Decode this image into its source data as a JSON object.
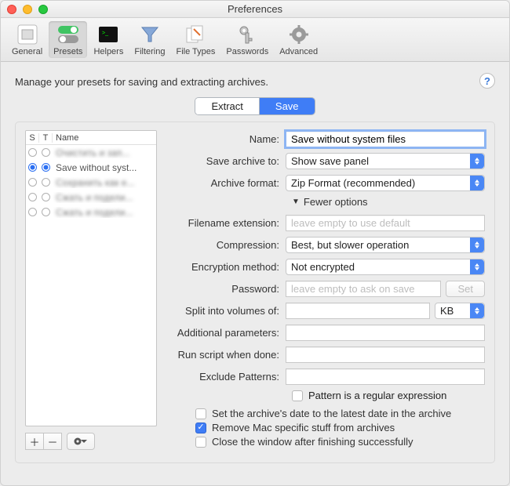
{
  "window": {
    "title": "Preferences"
  },
  "toolbar": {
    "items": [
      {
        "id": "general",
        "label": "General"
      },
      {
        "id": "presets",
        "label": "Presets"
      },
      {
        "id": "helpers",
        "label": "Helpers"
      },
      {
        "id": "filtering",
        "label": "Filtering"
      },
      {
        "id": "filetypes",
        "label": "File Types"
      },
      {
        "id": "passwords",
        "label": "Passwords"
      },
      {
        "id": "advanced",
        "label": "Advanced"
      }
    ],
    "selected": "presets"
  },
  "description": "Manage your presets for saving and extracting archives.",
  "tabs": {
    "extract": "Extract",
    "save": "Save",
    "active": "save"
  },
  "preset_list": {
    "headers": {
      "s": "S",
      "t": "T",
      "name": "Name"
    },
    "rows": [
      {
        "s": false,
        "t": false,
        "name": "Очистить и зап...",
        "blurred": true
      },
      {
        "s": true,
        "t": true,
        "name": "Save without syst...",
        "blurred": false
      },
      {
        "s": false,
        "t": false,
        "name": "Сохранить как е...",
        "blurred": true
      },
      {
        "s": false,
        "t": false,
        "name": "Сжать и подели...",
        "blurred": true
      },
      {
        "s": false,
        "t": false,
        "name": "Сжать и подели...",
        "blurred": true
      }
    ]
  },
  "form": {
    "name_label": "Name:",
    "name_value": "Save without system files",
    "save_to_label": "Save archive to:",
    "save_to_value": "Show save panel",
    "format_label": "Archive format:",
    "format_value": "Zip Format (recommended)",
    "disclosure": "Fewer options",
    "ext_label": "Filename extension:",
    "ext_placeholder": "leave empty to use default",
    "ext_value": "",
    "compression_label": "Compression:",
    "compression_value": "Best, but slower operation",
    "encryption_label": "Encryption method:",
    "encryption_value": "Not encrypted",
    "password_label": "Password:",
    "password_placeholder": "leave empty to ask on save",
    "password_value": "",
    "set_button": "Set",
    "split_label": "Split into volumes of:",
    "split_value": "",
    "split_unit": "KB",
    "params_label": "Additional parameters:",
    "params_value": "",
    "script_label": "Run script when done:",
    "script_value": "",
    "exclude_label": "Exclude Patterns:",
    "exclude_value": "",
    "regex_label": "Pattern is a regular expression",
    "regex_checked": false,
    "set_date_label": "Set the archive's date to the latest date in the archive",
    "set_date_checked": false,
    "remove_mac_label": "Remove Mac specific stuff from archives",
    "remove_mac_checked": true,
    "close_window_label": "Close the window after finishing successfully",
    "close_window_checked": false
  },
  "help_tooltip": "?"
}
